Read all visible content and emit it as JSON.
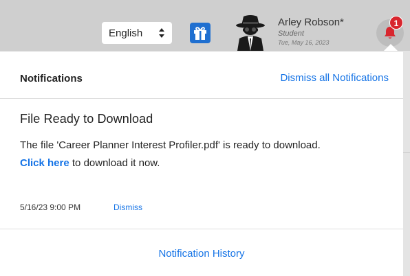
{
  "header": {
    "language": {
      "selected": "English",
      "icon": "updown-arrows-icon"
    },
    "gift_icon": "gift-icon",
    "avatar_icon": "spy-avatar-icon",
    "user": {
      "name": "Arley Robson*",
      "role": "Student",
      "date": "Tue, May 16, 2023"
    },
    "notifications": {
      "icon": "bell-icon",
      "badge_count": "1"
    }
  },
  "panel": {
    "title": "Notifications",
    "dismiss_all": "Dismiss all Notifications",
    "items": [
      {
        "title": "File Ready to Download",
        "message": "The file 'Career Planner Interest Profiler.pdf' is ready to download.",
        "link_text": "Click here",
        "link_suffix": " to download it now.",
        "timestamp": "5/16/23 9:00 PM",
        "dismiss": "Dismiss"
      }
    ],
    "history_link": "Notification History"
  },
  "colors": {
    "link": "#1473e6",
    "badge": "#d8262e",
    "gift": "#1f6fd0",
    "header_bg": "#cfcfcf"
  }
}
